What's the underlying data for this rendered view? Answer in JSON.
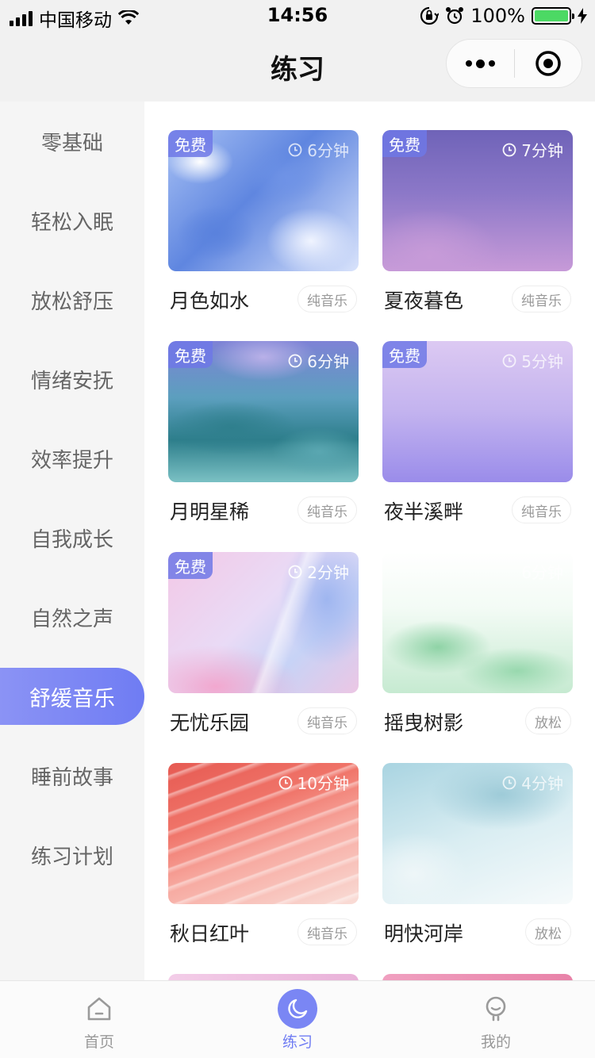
{
  "status_bar": {
    "carrier": "中国移动",
    "time": "14:56",
    "battery": "100%",
    "battery_level": 1.0
  },
  "nav": {
    "title": "练习",
    "more_icon": "more-dots-icon",
    "close_icon": "target-circle-icon"
  },
  "sidebar": {
    "items": [
      {
        "label": "零基础",
        "active": false
      },
      {
        "label": "轻松入眠",
        "active": false
      },
      {
        "label": "放松舒压",
        "active": false
      },
      {
        "label": "情绪安抚",
        "active": false
      },
      {
        "label": "效率提升",
        "active": false
      },
      {
        "label": "自我成长",
        "active": false
      },
      {
        "label": "自然之声",
        "active": false
      },
      {
        "label": "舒缓音乐",
        "active": true
      },
      {
        "label": "睡前故事",
        "active": false
      },
      {
        "label": "练习计划",
        "active": false
      }
    ]
  },
  "cards": [
    {
      "title": "月色如水",
      "tag": "纯音乐",
      "duration": "6分钟",
      "free": true,
      "free_label": "免费"
    },
    {
      "title": "夏夜暮色",
      "tag": "纯音乐",
      "duration": "7分钟",
      "free": true,
      "free_label": "免费"
    },
    {
      "title": "月明星稀",
      "tag": "纯音乐",
      "duration": "6分钟",
      "free": true,
      "free_label": "免费"
    },
    {
      "title": "夜半溪畔",
      "tag": "纯音乐",
      "duration": "5分钟",
      "free": true,
      "free_label": "免费"
    },
    {
      "title": "无忧乐园",
      "tag": "纯音乐",
      "duration": "2分钟",
      "free": true,
      "free_label": "免费"
    },
    {
      "title": "摇曳树影",
      "tag": "放松",
      "duration": "6分钟",
      "free": false,
      "free_label": ""
    },
    {
      "title": "秋日红叶",
      "tag": "纯音乐",
      "duration": "10分钟",
      "free": false,
      "free_label": ""
    },
    {
      "title": "明快河岸",
      "tag": "放松",
      "duration": "4分钟",
      "free": false,
      "free_label": ""
    }
  ],
  "tabbar": {
    "items": [
      {
        "label": "首页",
        "icon": "home-icon",
        "active": false
      },
      {
        "label": "练习",
        "icon": "moon-icon",
        "active": true
      },
      {
        "label": "我的",
        "icon": "profile-icon",
        "active": false
      }
    ]
  },
  "colors": {
    "accent": "#6f7cf3",
    "sidebar_bg": "#f5f5f5",
    "navbar_bg": "#f1f1f1"
  }
}
